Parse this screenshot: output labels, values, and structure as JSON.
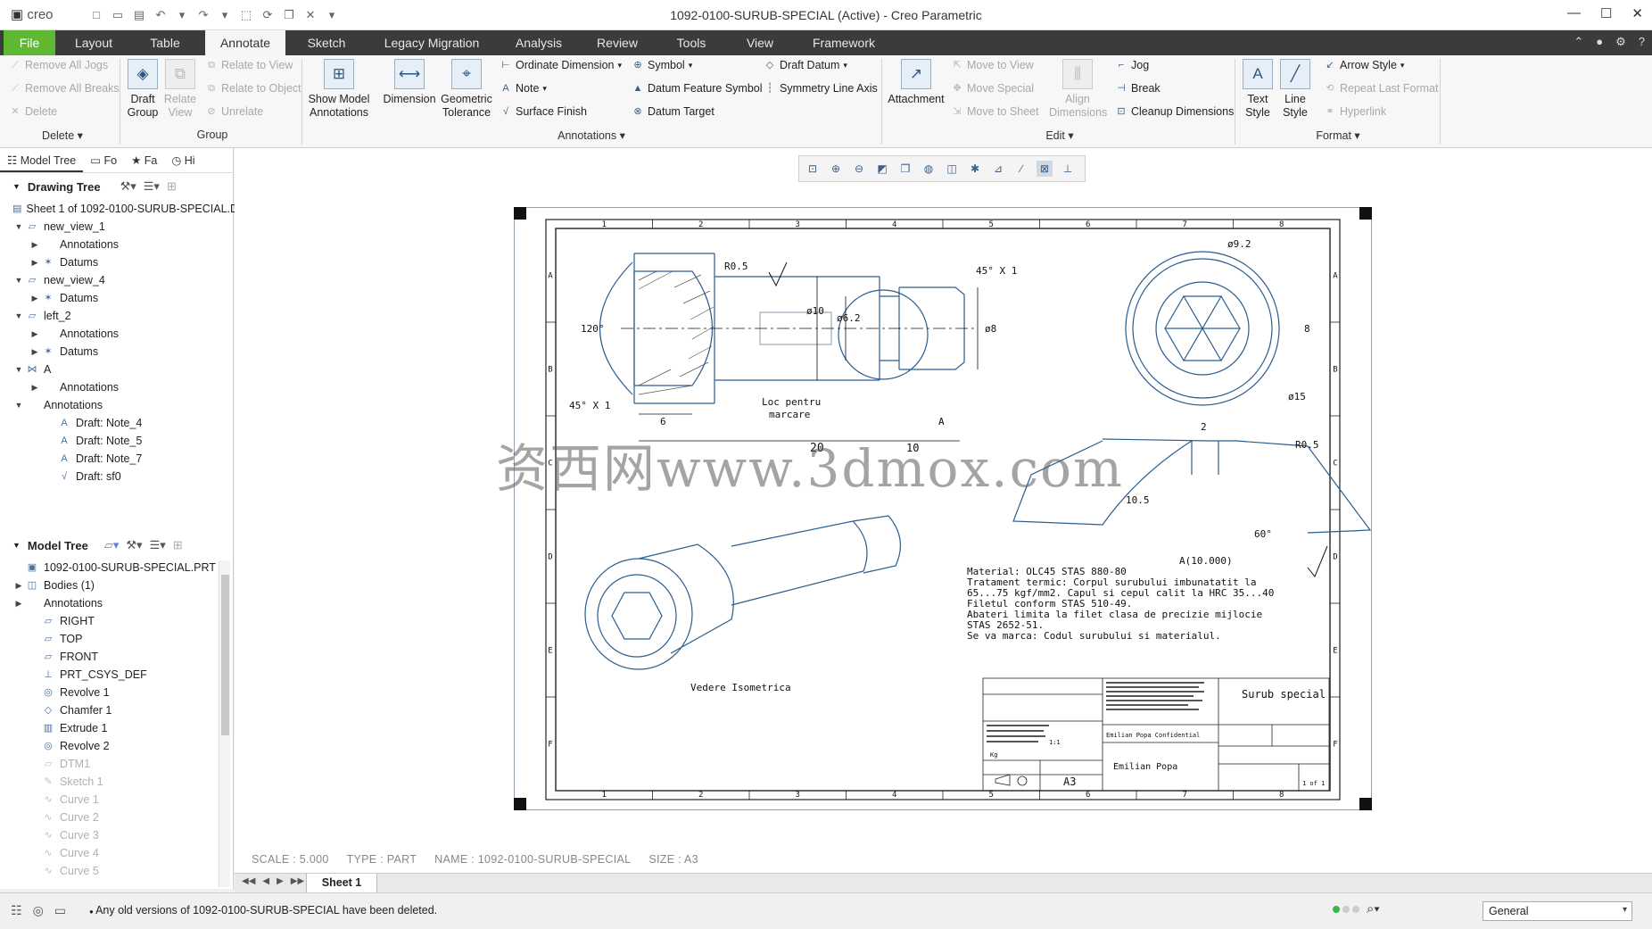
{
  "window": {
    "app_logo": "creo",
    "title": "1092-0100-SURUB-SPECIAL (Active) - Creo Parametric"
  },
  "tabs": [
    "File",
    "Layout",
    "Table",
    "Annotate",
    "Sketch",
    "Legacy Migration",
    "Analysis",
    "Review",
    "Tools",
    "View",
    "Framework"
  ],
  "active_tab": "Annotate",
  "ribbon": {
    "delete_group": {
      "remove_all_jogs": "Remove All Jogs",
      "remove_all_breaks": "Remove All Breaks",
      "delete": "Delete",
      "label": "Delete"
    },
    "group_group": {
      "draft_group": "Draft\nGroup",
      "relate_view": "Relate\nView",
      "relate_to_view": "Relate to View",
      "relate_to_object": "Relate to Object",
      "unrelate": "Unrelate",
      "label": "Group"
    },
    "annotations_group": {
      "show_model_annotations": "Show Model\nAnnotations",
      "dimension": "Dimension",
      "geometric_tolerance": "Geometric\nTolerance",
      "ordinate_dimension": "Ordinate Dimension",
      "note": "Note",
      "surface_finish": "Surface Finish",
      "symbol": "Symbol",
      "datum_feature_symbol": "Datum Feature Symbol",
      "datum_target": "Datum Target",
      "draft_datum": "Draft Datum",
      "symmetry_line_axis": "Symmetry Line Axis",
      "label": "Annotations"
    },
    "edit_group": {
      "attachment": "Attachment",
      "move_to_view": "Move to View",
      "move_special": "Move Special",
      "move_to_sheet": "Move to Sheet",
      "align_dimensions": "Align\nDimensions",
      "jog": "Jog",
      "break": "Break",
      "cleanup_dimensions": "Cleanup Dimensions",
      "label": "Edit"
    },
    "format_group": {
      "text_style": "Text\nStyle",
      "line_style": "Line\nStyle",
      "arrow_style": "Arrow Style",
      "repeat_last_format": "Repeat Last Format",
      "hyperlink": "Hyperlink",
      "label": "Format"
    }
  },
  "left_panel": {
    "tabs": [
      "Model Tree",
      "Fo",
      "Fa",
      "Hi"
    ],
    "drawing_tree": {
      "header": "Drawing Tree",
      "items": [
        {
          "label": "Sheet 1 of 1092-0100-SURUB-SPECIAL.DRW",
          "level": 0,
          "icon": "sheet-icon",
          "twisty": ""
        },
        {
          "label": "new_view_1",
          "level": 0,
          "icon": "view-icon",
          "twisty": "▼"
        },
        {
          "label": "Annotations",
          "level": 1,
          "icon": "",
          "twisty": "▶"
        },
        {
          "label": "Datums",
          "level": 1,
          "icon": "datum-icon",
          "twisty": "▶"
        },
        {
          "label": "new_view_4",
          "level": 0,
          "icon": "view-icon",
          "twisty": "▼"
        },
        {
          "label": "Datums",
          "level": 1,
          "icon": "datum-icon",
          "twisty": "▶"
        },
        {
          "label": "left_2",
          "level": 0,
          "icon": "view-icon",
          "twisty": "▼"
        },
        {
          "label": "Annotations",
          "level": 1,
          "icon": "",
          "twisty": "▶"
        },
        {
          "label": "Datums",
          "level": 1,
          "icon": "datum-icon",
          "twisty": "▶"
        },
        {
          "label": "A",
          "level": 0,
          "icon": "section-icon",
          "twisty": "▼"
        },
        {
          "label": "Annotations",
          "level": 1,
          "icon": "",
          "twisty": "▶"
        },
        {
          "label": "Annotations",
          "level": 0,
          "icon": "",
          "twisty": "▼"
        },
        {
          "label": "Draft: Note_4",
          "level": 2,
          "icon": "note-icon",
          "twisty": ""
        },
        {
          "label": "Draft: Note_5",
          "level": 2,
          "icon": "note-icon",
          "twisty": ""
        },
        {
          "label": "Draft: Note_7",
          "level": 2,
          "icon": "note-icon",
          "twisty": ""
        },
        {
          "label": "Draft: sf0",
          "level": 2,
          "icon": "surface-finish-icon",
          "twisty": ""
        }
      ]
    },
    "model_tree": {
      "header": "Model Tree",
      "items": [
        {
          "label": "1092-0100-SURUB-SPECIAL.PRT",
          "level": 0,
          "icon": "part-icon",
          "twisty": "",
          "dim": false
        },
        {
          "label": "Bodies (1)",
          "level": 0,
          "icon": "body-icon",
          "twisty": "▶",
          "dim": false
        },
        {
          "label": "Annotations",
          "level": 0,
          "icon": "",
          "twisty": "▶",
          "dim": false
        },
        {
          "label": "RIGHT",
          "level": 1,
          "icon": "plane-icon",
          "twisty": "",
          "dim": false
        },
        {
          "label": "TOP",
          "level": 1,
          "icon": "plane-icon",
          "twisty": "",
          "dim": false
        },
        {
          "label": "FRONT",
          "level": 1,
          "icon": "plane-icon",
          "twisty": "",
          "dim": false
        },
        {
          "label": "PRT_CSYS_DEF",
          "level": 1,
          "icon": "csys-icon",
          "twisty": "",
          "dim": false
        },
        {
          "label": "Revolve 1",
          "level": 1,
          "icon": "revolve-icon",
          "twisty": "",
          "dim": false
        },
        {
          "label": "Chamfer 1",
          "level": 1,
          "icon": "chamfer-icon",
          "twisty": "",
          "dim": false
        },
        {
          "label": "Extrude 1",
          "level": 1,
          "icon": "extrude-icon",
          "twisty": "",
          "dim": false
        },
        {
          "label": "Revolve 2",
          "level": 1,
          "icon": "revolve-icon",
          "twisty": "",
          "dim": false
        },
        {
          "label": "DTM1",
          "level": 1,
          "icon": "plane-icon",
          "twisty": "",
          "dim": true
        },
        {
          "label": "Sketch 1",
          "level": 1,
          "icon": "sketch-icon",
          "twisty": "",
          "dim": true
        },
        {
          "label": "Curve 1",
          "level": 1,
          "icon": "curve-icon",
          "twisty": "",
          "dim": true
        },
        {
          "label": "Curve 2",
          "level": 1,
          "icon": "curve-icon",
          "twisty": "",
          "dim": true
        },
        {
          "label": "Curve 3",
          "level": 1,
          "icon": "curve-icon",
          "twisty": "",
          "dim": true
        },
        {
          "label": "Curve 4",
          "level": 1,
          "icon": "curve-icon",
          "twisty": "",
          "dim": true
        },
        {
          "label": "Curve 5",
          "level": 1,
          "icon": "curve-icon",
          "twisty": "",
          "dim": true
        }
      ]
    }
  },
  "canvas": {
    "info": {
      "scale": "SCALE : 5.000",
      "type": "TYPE : PART",
      "name": "NAME : 1092-0100-SURUB-SPECIAL",
      "size": "SIZE : A3"
    },
    "sheet_tab": "Sheet 1",
    "watermark": "资西网www.3dmox.com"
  },
  "drawing": {
    "col_labels": [
      "1",
      "2",
      "3",
      "4",
      "5",
      "6",
      "7",
      "8"
    ],
    "row_labels": [
      "A",
      "B",
      "C",
      "D",
      "E",
      "F"
    ],
    "dims": {
      "r05_top": "R0.5",
      "deg120": "120°",
      "d10": "ø10",
      "d62": "ø6.2",
      "chamfer_right": "45° X 1",
      "d8_left": "ø8",
      "chamfer_left": "45° X 1",
      "len6": "6",
      "len20": "20",
      "len10": "10",
      "marking": "Loc pentru\nmarcare",
      "section_a": "A",
      "d92": "ø9.2",
      "d8_right": "8",
      "d15": "ø15",
      "len2": "2",
      "r05_detail": "R0.5",
      "len105": "10.5",
      "deg60": "60°",
      "detail_label": "A(10.000)"
    },
    "iso_label": "Vedere Isometrica",
    "notes": [
      "Material: OLC45 STAS 880-80",
      "Tratament termic: Corpul surubului imbunatatit la",
      "65...75 kgf/mm2. Capul si cepul calit la HRC 35...40",
      "Filetul conform STAS 510-49.",
      "Abateri limita la filet clasa de precizie mijlocie",
      "STAS 2652-51.",
      "Se va marca: Codul surubului si materialul."
    ],
    "title_block": {
      "description": "Surub special",
      "author": "Emilian Popa",
      "author_conf": "Emilian Popa Confidential",
      "size": "A3",
      "scale": "1:1",
      "sheet": "1 of 1",
      "weight": "Kg"
    }
  },
  "status": {
    "message": "Any old versions of 1092-0100-SURUB-SPECIAL have been deleted.",
    "filter": "General"
  }
}
